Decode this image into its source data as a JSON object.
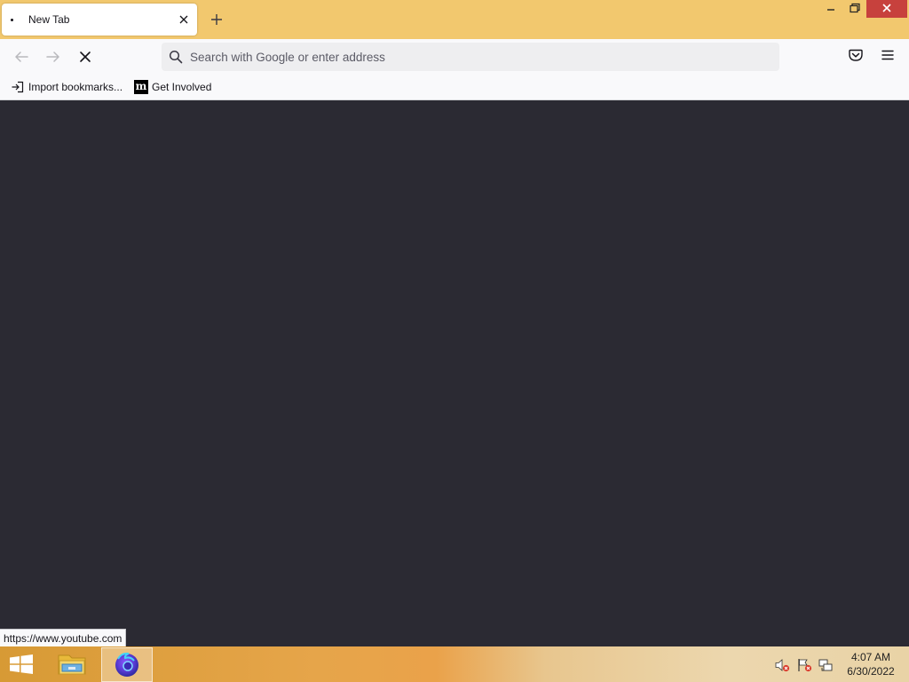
{
  "browser": {
    "tab": {
      "title": "New Tab"
    },
    "urlbar": {
      "placeholder": "Search with Google or enter address",
      "value": ""
    },
    "bookmarks": [
      {
        "label": "Import bookmarks...",
        "icon": "import-icon"
      },
      {
        "label": "Get Involved",
        "icon": "mozilla-icon",
        "logo_letter": "m"
      }
    ],
    "status_url": "https://www.youtube.com",
    "colors": {
      "titlebar": "#f2c86e",
      "toolbar": "#f9f9fb",
      "content_bg": "#2b2a33",
      "close_button": "#c7413d"
    }
  },
  "taskbar": {
    "time": "4:07 AM",
    "date": "6/30/2022",
    "pinned": [
      "windows-start-icon",
      "file-explorer-icon",
      "firefox-icon"
    ],
    "tray": [
      "volume-muted-icon",
      "action-center-flag-icon",
      "network-icon"
    ]
  }
}
